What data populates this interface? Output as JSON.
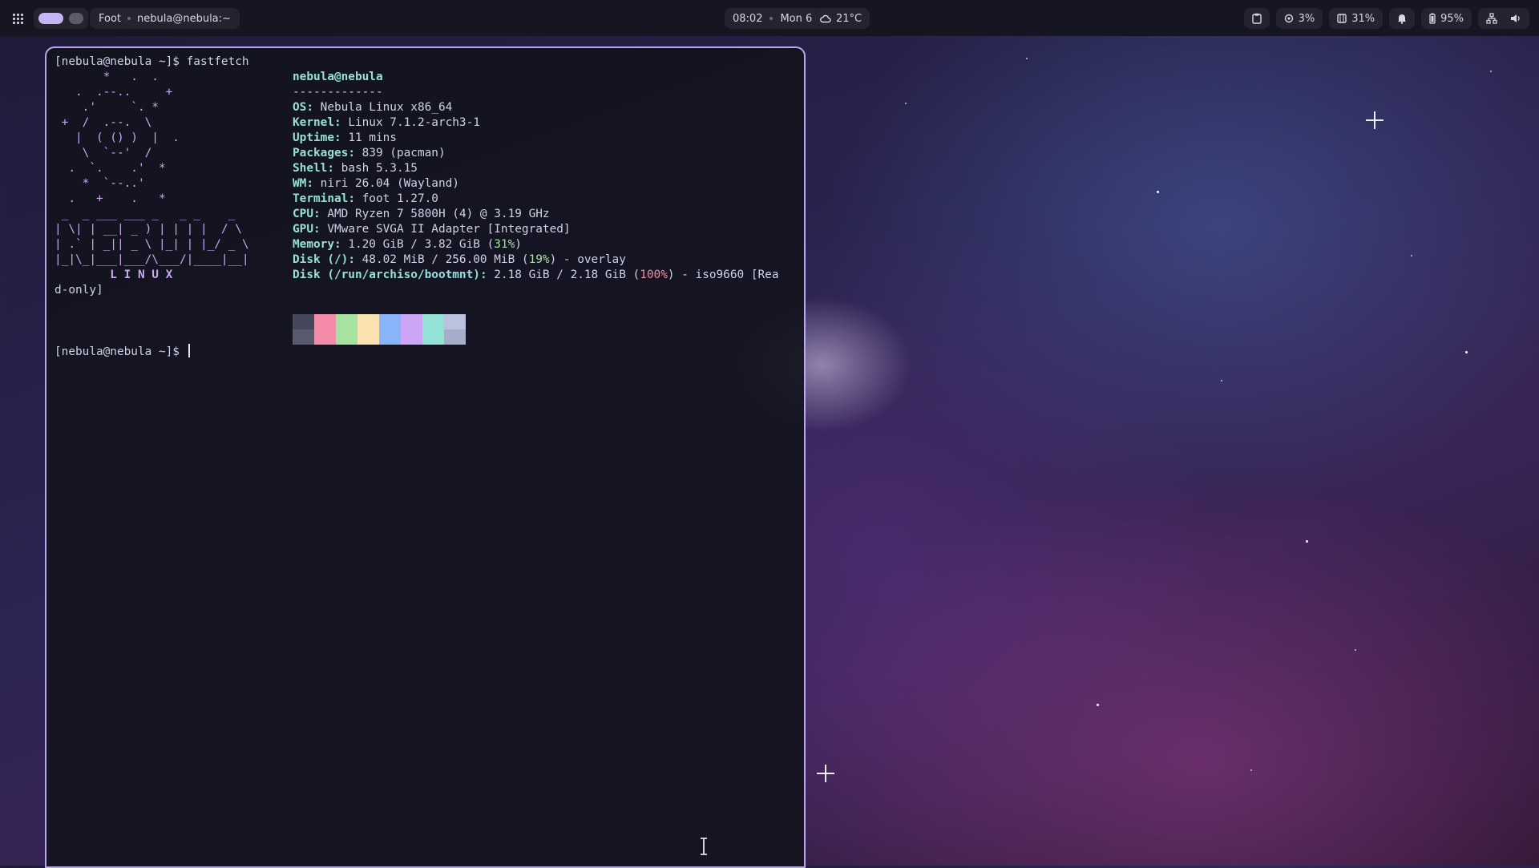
{
  "topbar": {
    "app_name": "Foot",
    "window_title": "nebula@nebula:~",
    "time": "08:02",
    "date": "Mon 6",
    "weather": "21°C",
    "cpu": "3%",
    "memory": "31%",
    "battery": "95%"
  },
  "terminal": {
    "prompt_line": "[nebula@nebula ~]$ fastfetch",
    "prompt": "[nebula@nebula ~]$",
    "logo_lines": [
      "       *   .  .",
      "   .  .--..     +",
      "    .'     `. *",
      " +  /  .--.  \\",
      "   |  ( () )  |  .",
      "    \\  `--'  /",
      "  .  `.    .'  *",
      "    *  `--..'",
      "  .   +    .   *",
      " _  _ ___ ___ _   _ _    _",
      "| \\| | __| _ ) | | | |  / \\",
      "| .` | _|| _ \\ |_| | |_/ _ \\",
      "|_|\\_|___|___/\\___/|____|__|",
      "        L I N U X"
    ],
    "wrap_line": "d-only]",
    "info_title": "nebula@nebula",
    "separator": "-------------",
    "info": [
      {
        "key": "OS",
        "value": "Nebula Linux x86_64"
      },
      {
        "key": "Kernel",
        "value": "Linux 7.1.2-arch3-1"
      },
      {
        "key": "Uptime",
        "value": "11 mins"
      },
      {
        "key": "Packages",
        "value": "839 (pacman)"
      },
      {
        "key": "Shell",
        "value": "bash 5.3.15"
      },
      {
        "key": "WM",
        "value": "niri 26.04 (Wayland)"
      },
      {
        "key": "Terminal",
        "value": "foot 1.27.0"
      },
      {
        "key": "CPU",
        "value": "AMD Ryzen 7 5800H (4) @ 3.19 GHz"
      },
      {
        "key": "GPU",
        "value": "VMware SVGA II Adapter [Integrated]"
      }
    ],
    "memory": {
      "key": "Memory",
      "pre": "1.20 GiB / 3.82 GiB (",
      "pct": "31%",
      "post": ")"
    },
    "disk_root": {
      "key": "Disk (/)",
      "pre": "48.02 MiB / 256.00 MiB (",
      "pct": "19%",
      "post": ") - overlay"
    },
    "disk_boot": {
      "key": "Disk (/run/archiso/bootmnt)",
      "pre": "2.18 GiB / 2.18 GiB (",
      "pct": "100%",
      "post": ") - iso9660 [Rea"
    },
    "palette": {
      "top": [
        "#45475a",
        "#f38ba8",
        "#a6e3a1",
        "#f9e2af",
        "#89b4fa",
        "#cba6f7",
        "#94e2d5",
        "#bac2de"
      ],
      "bottom": [
        "#585b70",
        "#f38ba8",
        "#a6e3a1",
        "#f9e2af",
        "#89b4fa",
        "#cba6f7",
        "#94e2d5",
        "#a6adc8"
      ]
    }
  },
  "icons": [
    "apps-grid-icon",
    "clipboard-icon",
    "cpu-icon",
    "memory-icon",
    "bell-icon",
    "battery-icon",
    "network-icon",
    "volume-icon",
    "text-cursor-icon"
  ]
}
